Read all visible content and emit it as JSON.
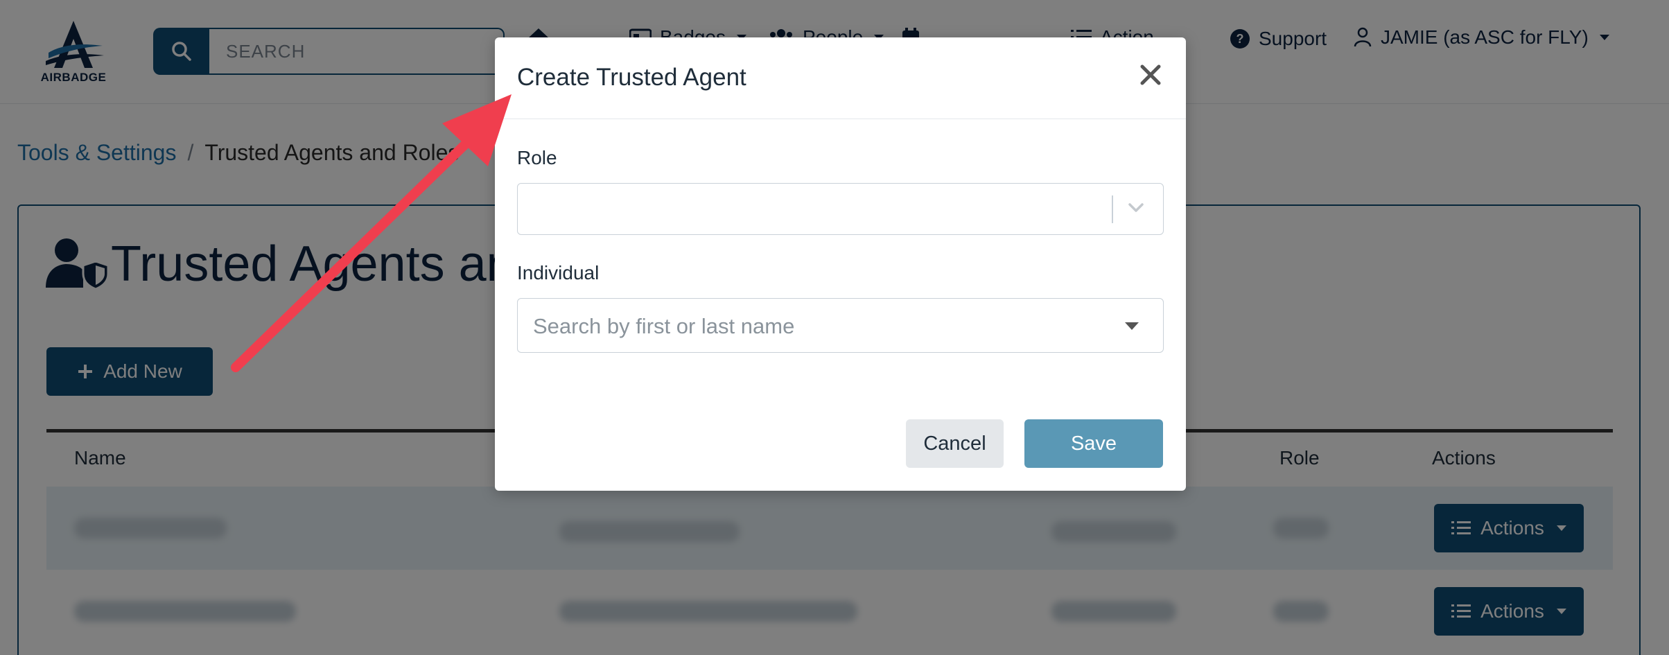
{
  "header": {
    "logo_text": "AIRBADGE",
    "search_placeholder": "SEARCH",
    "nav": {
      "badges": "Badges",
      "people": "People",
      "action": "Action",
      "support": "Support",
      "user": "JAMIE (as ASC for FLY)"
    }
  },
  "breadcrumb": {
    "parent": "Tools & Settings",
    "separator": "/",
    "current": "Trusted Agents and Roles"
  },
  "page": {
    "title": "Trusted Agents and Roles",
    "add_button": "Add New"
  },
  "table": {
    "columns": [
      "Name",
      "Role",
      "Actions"
    ],
    "row_action_label": "Actions"
  },
  "modal": {
    "title": "Create Trusted Agent",
    "role_label": "Role",
    "role_value": "",
    "individual_label": "Individual",
    "individual_placeholder": "Search by first or last name",
    "cancel_label": "Cancel",
    "save_label": "Save"
  },
  "colors": {
    "brand_navy": "#0f4c75",
    "save_button": "#5a98b5",
    "annotation_arrow": "#f03e4e"
  }
}
